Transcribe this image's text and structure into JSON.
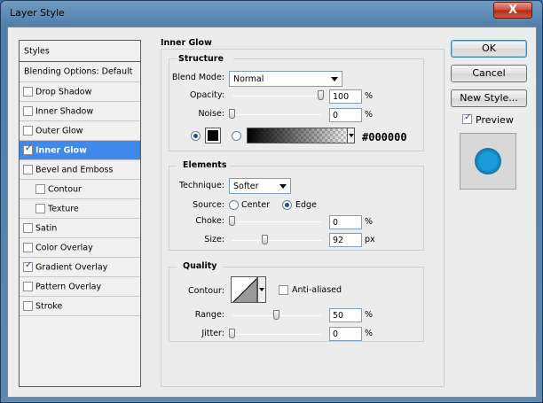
{
  "window": {
    "title": "Layer Style",
    "close_label": "X"
  },
  "styles_panel": {
    "header": "Styles",
    "blending_options": "Blending Options: Default",
    "items": [
      {
        "label": "Drop Shadow",
        "checked": false
      },
      {
        "label": "Inner Shadow",
        "checked": false
      },
      {
        "label": "Outer Glow",
        "checked": false
      },
      {
        "label": "Inner Glow",
        "checked": true,
        "selected": true
      },
      {
        "label": "Bevel and Emboss",
        "checked": false
      },
      {
        "label": "Contour",
        "checked": false,
        "indent": true
      },
      {
        "label": "Texture",
        "checked": false,
        "indent": true
      },
      {
        "label": "Satin",
        "checked": false
      },
      {
        "label": "Color Overlay",
        "checked": false
      },
      {
        "label": "Gradient Overlay",
        "checked": true
      },
      {
        "label": "Pattern Overlay",
        "checked": false
      },
      {
        "label": "Stroke",
        "checked": false
      }
    ]
  },
  "inner_glow": {
    "title": "Inner Glow",
    "structure": {
      "title": "Structure",
      "blend_mode_label": "Blend Mode:",
      "blend_mode": "Normal",
      "opacity_label": "Opacity:",
      "opacity": "100",
      "opacity_unit": "%",
      "opacity_level": 1.0,
      "noise_label": "Noise:",
      "noise": "0",
      "noise_unit": "%",
      "noise_level": 0.0,
      "color_hex": "#000000",
      "color_mode": "solid"
    },
    "elements": {
      "title": "Elements",
      "technique_label": "Technique:",
      "technique": "Softer",
      "source_label": "Source:",
      "source_center": "Center",
      "source_edge": "Edge",
      "source_selected": "Edge",
      "choke_label": "Choke:",
      "choke": "0",
      "choke_unit": "%",
      "choke_level": 0.0,
      "size_label": "Size:",
      "size": "92",
      "size_unit": "px",
      "size_level": 0.37
    },
    "quality": {
      "title": "Quality",
      "contour_label": "Contour:",
      "anti_aliased_label": "Anti-aliased",
      "anti_aliased": false,
      "range_label": "Range:",
      "range": "50",
      "range_unit": "%",
      "range_level": 0.5,
      "jitter_label": "Jitter:",
      "jitter": "0",
      "jitter_unit": "%",
      "jitter_level": 0.0
    }
  },
  "buttons": {
    "ok": "OK",
    "cancel": "Cancel",
    "new_style": "New Style..."
  },
  "preview": {
    "label": "Preview",
    "checked": true
  },
  "colors": {
    "selection": "#3f89ed",
    "glow_preview": "#1b9cd9"
  }
}
